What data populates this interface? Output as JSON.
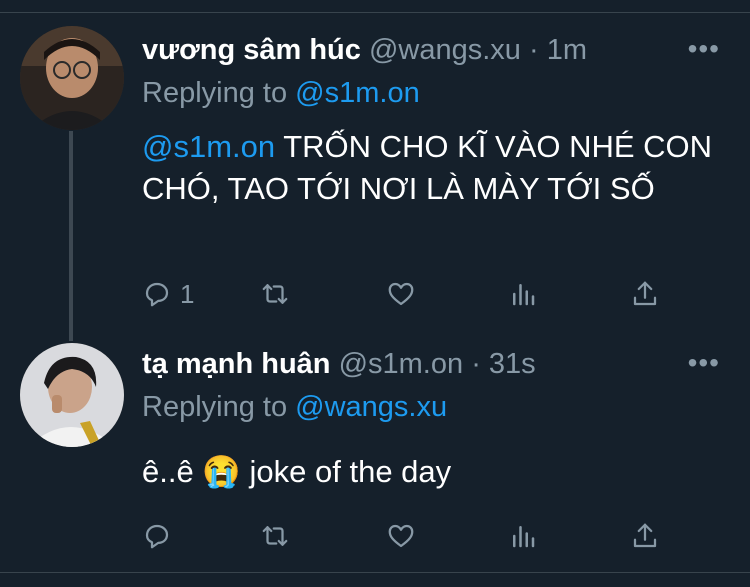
{
  "tweets": [
    {
      "name": "vương sâm húc",
      "handle": "@wangs.xu",
      "separator": "·",
      "time": "1m",
      "more": "•••",
      "replying_prefix": "Replying to",
      "replying_to": "@s1m.on",
      "mention": "@s1m.on",
      "text": " TRỐN CHO KĨ VÀO NHÉ CON CHÓ, TAO TỚI NƠI LÀ MÀY TỚI SỐ",
      "reply_count": "1",
      "icons": [
        "reply-icon",
        "retweet-icon",
        "like-icon",
        "analytics-icon",
        "share-icon"
      ]
    },
    {
      "name": "tạ mạnh huân",
      "handle": "@s1m.on",
      "separator": "·",
      "time": "31s",
      "more": "•••",
      "replying_prefix": "Replying to",
      "replying_to": "@wangs.xu",
      "text": "ê..ê 😭  joke of the day",
      "icons": [
        "reply-icon",
        "retweet-icon",
        "like-icon",
        "analytics-icon",
        "share-icon"
      ]
    }
  ],
  "colors": {
    "background": "#15202b",
    "secondary_text": "#8899a6",
    "link": "#1d9bf0",
    "divider": "#38444d"
  }
}
